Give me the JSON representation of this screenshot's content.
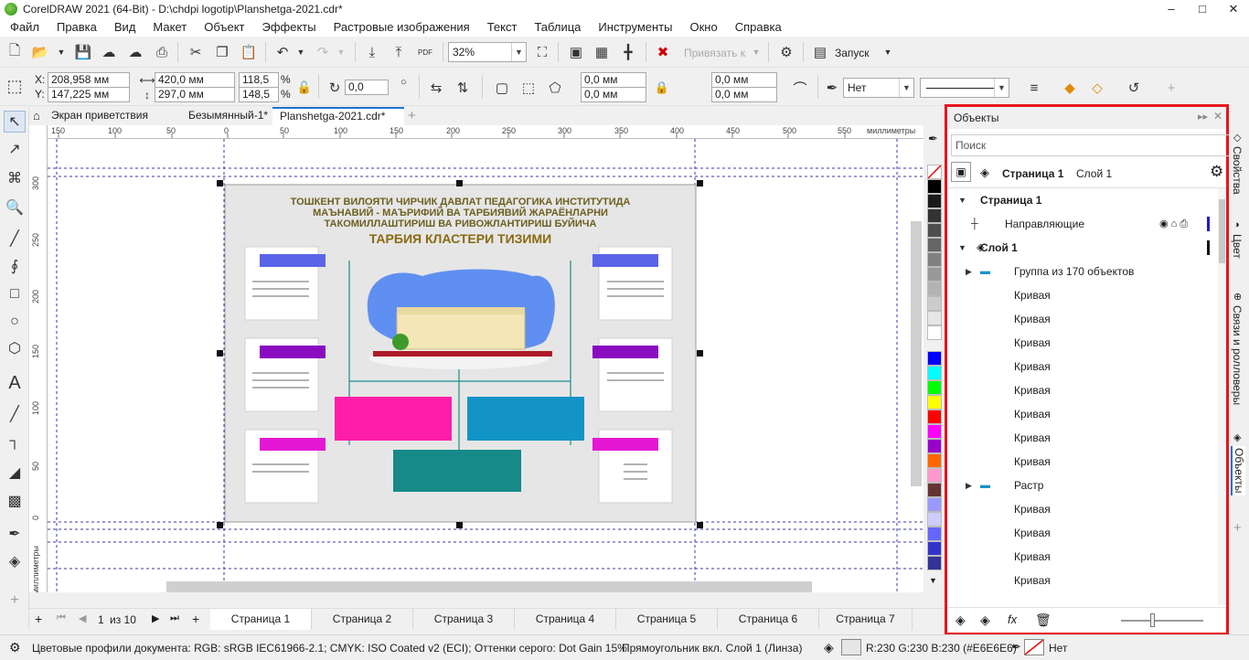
{
  "window": {
    "title": "CorelDRAW 2021 (64-Bit) - D:\\chdpi logotip\\Planshetga-2021.cdr*",
    "buttons": [
      "–",
      "□",
      "✕"
    ]
  },
  "menu": [
    "Файл",
    "Правка",
    "Вид",
    "Макет",
    "Объект",
    "Эффекты",
    "Растровые изображения",
    "Текст",
    "Таблица",
    "Инструменты",
    "Окно",
    "Справка"
  ],
  "toolbar": {
    "zoom": "32%",
    "snap_label": "Привязать к",
    "launch_label": "Запуск"
  },
  "propbar": {
    "x_label": "X:",
    "x": "208,958 мм",
    "y_label": "Y:",
    "y": "147,225 мм",
    "w": "420,0 мм",
    "h": "297,0 мм",
    "sx": "118,5",
    "sy": "148,5",
    "pct": "%",
    "rotation": "0,0",
    "corner1": "0,0 мм",
    "corner2": "0,0 мм",
    "corner3": "0,0 мм",
    "corner4": "0,0 мм",
    "outline": "Нет"
  },
  "doctabs": [
    "Экран приветствия",
    "Безымянный-1*",
    "Planshetga-2021.cdr*"
  ],
  "ruler": {
    "h_ticks": [
      "150",
      "100",
      "50",
      "0",
      "50",
      "100",
      "150",
      "200",
      "250",
      "300",
      "350",
      "400",
      "450",
      "500",
      "550"
    ],
    "h_unit": "миллиметры",
    "v_ticks": [
      "300",
      "250",
      "200",
      "150",
      "100",
      "50",
      "0"
    ],
    "v_unit": "миллиметры"
  },
  "poster": {
    "line1": "ТОШКЕНТ ВИЛОЯТИ ЧИРЧИК ДАВЛАТ ПЕДАГОГИКА ИНСТИТУТИДА",
    "line2": "МАЪНАВИЙ - МАЪРИФИЙ ВА ТАРБИЯВИЙ ЖАРАЁНЛАРНИ",
    "line3": "ТАКОМИЛЛАШТИРИШ ВА РИВОЖЛАНТИРИШ  БУЙИЧА",
    "heading": "ТАРБИЯ КЛАСТЕРИ ТИЗИМИ"
  },
  "pages": {
    "current": "1",
    "of": "из 10",
    "tabs": [
      "Страница 1",
      "Страница 2",
      "Страница 3",
      "Страница 4",
      "Страница 5",
      "Страница 6",
      "Страница 7"
    ]
  },
  "objects_panel": {
    "title": "Объекты",
    "search_placeholder": "Поиск",
    "page_label": "Страница 1",
    "layer_label": "Слой 1",
    "rows": [
      {
        "label": "Страница 1",
        "bold": true,
        "indent": 0,
        "twisty": "▼"
      },
      {
        "label": "Направляющие",
        "bold": false,
        "indent": 1,
        "twisty": ""
      },
      {
        "label": "Слой 1",
        "bold": true,
        "indent": 0,
        "twisty": "▼"
      },
      {
        "label": "Группа из 170 объектов",
        "bold": false,
        "indent": 2,
        "twisty": "▶"
      },
      {
        "label": "Кривая",
        "bold": false,
        "indent": 2,
        "twisty": ""
      },
      {
        "label": "Кривая",
        "bold": false,
        "indent": 2,
        "twisty": ""
      },
      {
        "label": "Кривая",
        "bold": false,
        "indent": 2,
        "twisty": ""
      },
      {
        "label": "Кривая",
        "bold": false,
        "indent": 2,
        "twisty": ""
      },
      {
        "label": "Кривая",
        "bold": false,
        "indent": 2,
        "twisty": ""
      },
      {
        "label": "Кривая",
        "bold": false,
        "indent": 2,
        "twisty": ""
      },
      {
        "label": "Кривая",
        "bold": false,
        "indent": 2,
        "twisty": ""
      },
      {
        "label": "Кривая",
        "bold": false,
        "indent": 2,
        "twisty": ""
      },
      {
        "label": "Растр",
        "bold": false,
        "indent": 2,
        "twisty": "▶"
      },
      {
        "label": "Кривая",
        "bold": false,
        "indent": 2,
        "twisty": ""
      },
      {
        "label": "Кривая",
        "bold": false,
        "indent": 2,
        "twisty": ""
      },
      {
        "label": "Кривая",
        "bold": false,
        "indent": 2,
        "twisty": ""
      },
      {
        "label": "Кривая",
        "bold": false,
        "indent": 2,
        "twisty": ""
      }
    ]
  },
  "side_tabs": [
    "Свойства",
    "Цвет",
    "Связи и ролловеры",
    "Объекты"
  ],
  "palette": [
    "#000000",
    "#1a1a1a",
    "#333333",
    "#4d4d4d",
    "#666666",
    "#808080",
    "#999999",
    "#b3b3b3",
    "#cccccc",
    "#e6e6e6",
    "#ffffff",
    "#0000ff",
    "#00ffff",
    "#00ff00",
    "#ffff00",
    "#ff0000",
    "#ff00ff",
    "#9900cc",
    "#ff6600",
    "#ff99cc",
    "#663333",
    "#9999ff",
    "#ccccff",
    "#6666ff",
    "#3333cc",
    "#333399"
  ],
  "statusbar": {
    "color_profiles": "Цветовые профили документа: RGB: sRGB IEC61966-2.1; CMYK: ISO Coated v2 (ECI); Оттенки серого: Dot Gain 15%",
    "selection": "Прямоугольник вкл. Слой 1  (Линза)",
    "fill": "R:230 G:230 B:230 (#E6E6E6)",
    "outline": "Нет"
  }
}
